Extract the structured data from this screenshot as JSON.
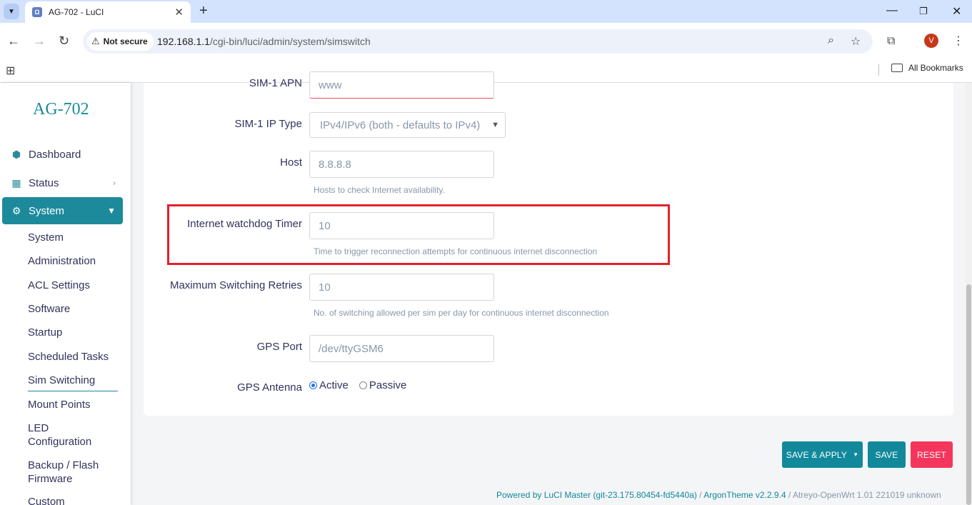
{
  "browser": {
    "tab_title": "AG-702 - LuCI",
    "tab_favicon": "Ω",
    "tab_close": "✕",
    "new_tab": "+",
    "security_label": "Not secure",
    "url_host": "192.168.1.1",
    "url_path": "/cgi-bin/luci/admin/system/simswitch",
    "avatar_letter": "V",
    "all_bookmarks": "All Bookmarks"
  },
  "sidebar": {
    "brand": "AG-702",
    "menu": [
      {
        "label": "Dashboard",
        "icon": "cube-icon"
      },
      {
        "label": "Status",
        "icon": "grid-icon"
      },
      {
        "label": "System",
        "icon": "gear-icon"
      }
    ],
    "system_items": [
      "System",
      "Administration",
      "ACL Settings",
      "Software",
      "Startup",
      "Scheduled Tasks",
      "Sim Switching",
      "Mount Points",
      "LED Configuration",
      "Backup / Flash Firmware",
      "Custom"
    ],
    "active_subitem": "Sim Switching"
  },
  "form": {
    "sim1_apn": {
      "label": "SIM-1 APN",
      "value": "www"
    },
    "sim1_ip_type": {
      "label": "SIM-1 IP Type",
      "value": "IPv4/IPv6 (both - defaults to IPv4)"
    },
    "host": {
      "label": "Host",
      "value": "8.8.8.8",
      "help": "Hosts to check Internet availability."
    },
    "watchdog": {
      "label": "Internet watchdog Timer",
      "value": "10",
      "help": "Time to trigger reconnection attempts for continuous internet disconnection"
    },
    "max_retries": {
      "label": "Maximum Switching Retries",
      "value": "10",
      "help": "No. of switching allowed per sim per day for continuous internet disconnection"
    },
    "gps_port": {
      "label": "GPS Port",
      "value": "/dev/ttyGSM6"
    },
    "gps_antenna": {
      "label": "GPS Antenna",
      "options": [
        "Active",
        "Passive"
      ],
      "selected": "Active"
    }
  },
  "actions": {
    "save_apply": "SAVE & APPLY",
    "save": "SAVE",
    "reset": "RESET"
  },
  "footer": {
    "luci": "Powered by LuCI Master (git-23.175.80454-fd5440a)",
    "sep": " / ",
    "theme": "ArgonTheme v2.2.9.4",
    "build": "Atreyo-OpenWrt 1.01 221019 unknown"
  },
  "colors": {
    "accent": "#11899b",
    "danger": "#f5365c",
    "highlight_box": "#e41f2b"
  }
}
